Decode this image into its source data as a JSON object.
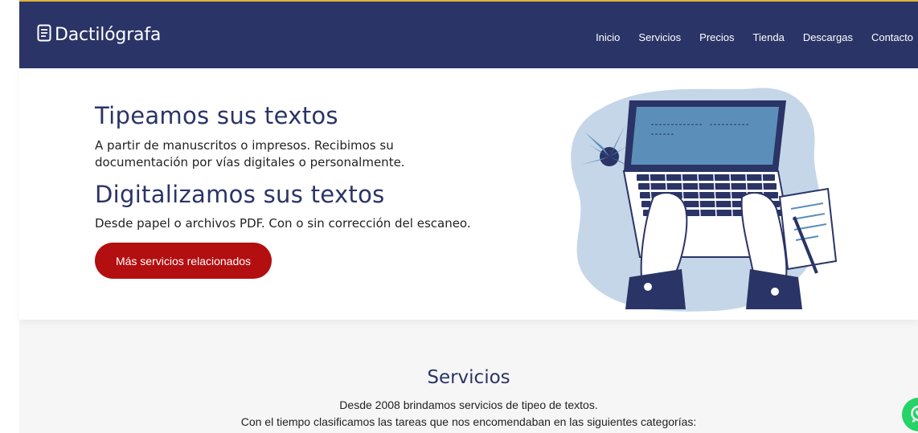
{
  "header": {
    "logo_text": "Dactilógrafa",
    "logo_icon": "document-icon",
    "nav": [
      "Inicio",
      "Servicios",
      "Precios",
      "Tienda",
      "Descargas",
      "Contacto"
    ]
  },
  "hero": {
    "title1": "Tipeamos sus textos",
    "text1": "A partir de manuscritos o impresos. Recibimos su documentación por vías digitales o personalmente.",
    "title2": "Digitalizamos sus textos",
    "text2": "Desde papel o archivos PDF. Con o sin corrección del escaneo.",
    "cta_label": "Más servicios relacionados",
    "illustration_icon": "laptop-typing-illustration"
  },
  "services": {
    "title": "Servicios",
    "line1": "Desde 2008 brindamos servicios de tipeo de textos.",
    "line2": "Con el tiempo clasificamos las tareas que nos encomendaban en las siguientes categorías:"
  },
  "floating": {
    "whatsapp_icon": "whatsapp-icon"
  },
  "colors": {
    "header_bg": "#2b3466",
    "accent": "#b30e10",
    "title": "#2b3466",
    "whatsapp": "#25d366",
    "frame": "#e0b23a"
  }
}
